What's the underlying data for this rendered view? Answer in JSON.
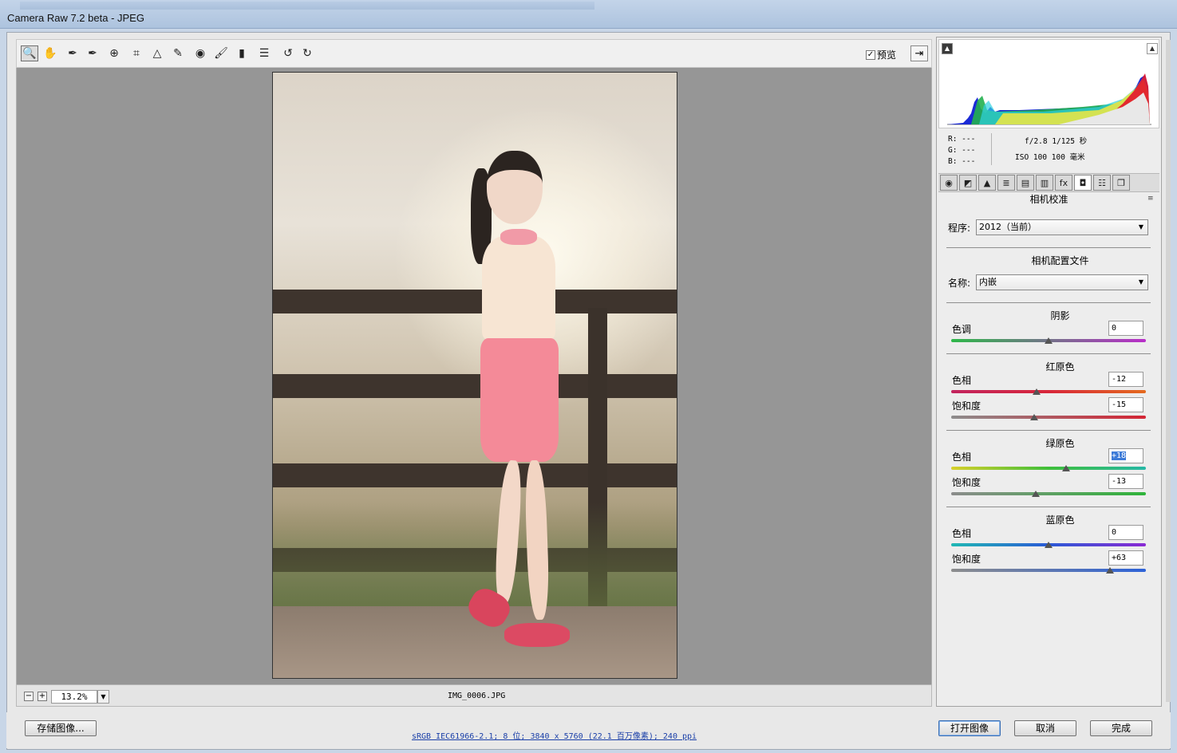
{
  "window": {
    "title": "Camera Raw 7.2 beta -  JPEG"
  },
  "toolbar": {
    "tools": [
      {
        "name": "zoom-tool",
        "glyph": "🔍"
      },
      {
        "name": "hand-tool",
        "glyph": "✋"
      },
      {
        "name": "white-balance-tool",
        "glyph": "✒"
      },
      {
        "name": "color-sampler-tool",
        "glyph": "✒"
      },
      {
        "name": "targeted-adjustment-tool",
        "glyph": "⊕"
      },
      {
        "name": "crop-tool",
        "glyph": "⌗"
      },
      {
        "name": "straighten-tool",
        "glyph": "△"
      },
      {
        "name": "spot-removal-tool",
        "glyph": "✎"
      },
      {
        "name": "red-eye-tool",
        "glyph": "◉"
      },
      {
        "name": "adjustment-brush-tool",
        "glyph": "🖌"
      },
      {
        "name": "graduated-filter-tool",
        "glyph": "▮"
      },
      {
        "name": "preferences-tool",
        "glyph": "☰"
      },
      {
        "name": "rotate-left-tool",
        "glyph": "↺"
      },
      {
        "name": "rotate-right-tool",
        "glyph": "↻"
      }
    ],
    "preview_label": "预览",
    "preview_checked": "✓",
    "fullscreen_glyph": "⇥"
  },
  "canvas": {
    "zoom_minus": "−",
    "zoom_plus": "+",
    "zoom_value": "13.2%",
    "zoom_dropdown": "▼",
    "filename": "IMG_0006.JPG"
  },
  "histogram": {
    "shadow_clip_glyph": "▲",
    "highlight_clip_glyph": "▲"
  },
  "camera_info": {
    "r": "R:  ---",
    "g": "G:  ---",
    "b": "B:  ---",
    "aperture_shutter": "f/2.8   1/125 秒",
    "iso_focal": "ISO 100   100 毫米"
  },
  "panel_tabs": [
    {
      "name": "tab-basic-icon",
      "glyph": "◉"
    },
    {
      "name": "tab-tone-curve-icon",
      "glyph": "◩"
    },
    {
      "name": "tab-detail-icon",
      "glyph": "▲"
    },
    {
      "name": "tab-hsl-icon",
      "glyph": "≣"
    },
    {
      "name": "tab-split-toning-icon",
      "glyph": "▤"
    },
    {
      "name": "tab-lens-corrections-icon",
      "glyph": "▥"
    },
    {
      "name": "tab-effects-icon",
      "glyph": "fx"
    },
    {
      "name": "tab-camera-calibration-icon",
      "glyph": "◘"
    },
    {
      "name": "tab-presets-icon",
      "glyph": "☷"
    },
    {
      "name": "tab-snapshots-icon",
      "glyph": "❐"
    }
  ],
  "calibration": {
    "title": "相机校准",
    "menu_glyph": "≡",
    "process_label": "程序:",
    "process_value": "2012（当前）",
    "profile_heading": "相机配置文件",
    "name_label": "名称:",
    "name_value": "内嵌",
    "dropdown_glyph": "▼",
    "shadows": {
      "title": "阴影",
      "tint_label": "色调",
      "tint_value": "0",
      "tint_level": 0
    },
    "red": {
      "title": "红原色",
      "hue_label": "色相",
      "hue_value": "-12",
      "hue_level": -12,
      "sat_label": "饱和度",
      "sat_value": "-15",
      "sat_level": -15
    },
    "green": {
      "title": "绿原色",
      "hue_label": "色相",
      "hue_value": "+18",
      "hue_level": 18,
      "sat_label": "饱和度",
      "sat_value": "-13",
      "sat_level": -13
    },
    "blue": {
      "title": "蓝原色",
      "hue_label": "色相",
      "hue_value": "0",
      "hue_level": 0,
      "sat_label": "饱和度",
      "sat_value": "+63",
      "sat_level": 63
    }
  },
  "bottom": {
    "save_label": "存储图像...",
    "workflow_link": "sRGB IEC61966-2.1; 8 位; 3840 x 5760 (22.1 百万像素); 240 ppi",
    "open_label": "打开图像",
    "cancel_label": "取消",
    "done_label": "完成"
  },
  "colors": {
    "canvas_bg": "#969696",
    "panel_bg": "#ededed",
    "selection": "#3d7bd8"
  }
}
